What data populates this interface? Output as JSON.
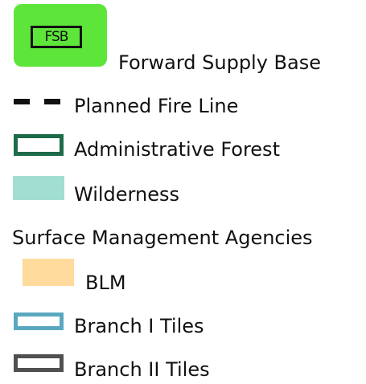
{
  "legend": {
    "forward_supply_base": {
      "symbol_text": "FSB",
      "label": "Forward Supply Base",
      "fill_color": "#5ee53a",
      "icon": "fsb-icon"
    },
    "planned_fire_line": {
      "label": "Planned Fire Line",
      "line_color": "#111111",
      "style": "dashed"
    },
    "administrative_forest": {
      "label": "Administrative Forest",
      "outline_color": "#1e6b4a"
    },
    "wilderness": {
      "label": "Wilderness",
      "fill_color": "#a2dfd2"
    },
    "surface_management_agencies": {
      "heading": "Surface Management Agencies",
      "items": [
        {
          "label": "BLM",
          "fill_color": "#fedb9c"
        }
      ]
    },
    "branch_i_tiles": {
      "label": "Branch I Tiles",
      "outline_color": "#5aa8c0"
    },
    "branch_ii_tiles": {
      "label": "Branch II Tiles",
      "outline_color": "#505050"
    }
  }
}
